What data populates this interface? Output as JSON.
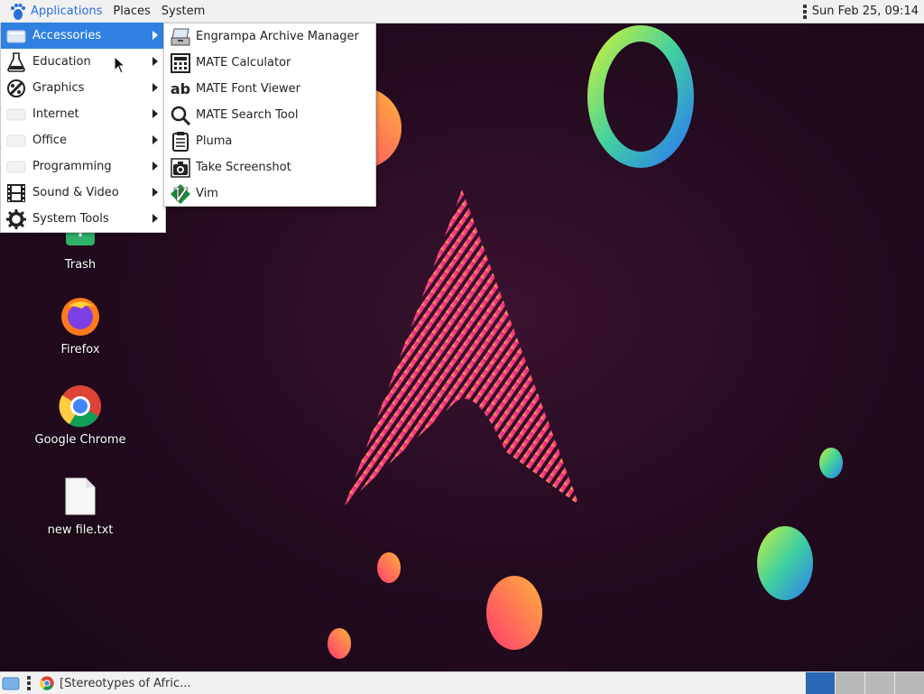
{
  "top_panel": {
    "menus": [
      {
        "label": "Applications",
        "icon": "mate-foot-icon"
      },
      {
        "label": "Places"
      },
      {
        "label": "System"
      }
    ],
    "clock": "Sun Feb 25, 09:14"
  },
  "apps_menu": {
    "items": [
      {
        "label": "Accessories",
        "icon": "accessories-icon",
        "selected": true
      },
      {
        "label": "Education",
        "icon": "flask-icon"
      },
      {
        "label": "Graphics",
        "icon": "graphics-icon"
      },
      {
        "label": "Internet",
        "icon": "internet-icon"
      },
      {
        "label": "Office",
        "icon": "office-icon"
      },
      {
        "label": "Programming",
        "icon": "programming-icon"
      },
      {
        "label": "Sound & Video",
        "icon": "film-icon"
      },
      {
        "label": "System Tools",
        "icon": "gear-icon"
      }
    ]
  },
  "submenu": {
    "items": [
      {
        "label": "Engrampa Archive Manager",
        "icon": "archive-icon"
      },
      {
        "label": "MATE Calculator",
        "icon": "calculator-icon"
      },
      {
        "label": "MATE Font Viewer",
        "icon": "font-icon"
      },
      {
        "label": "MATE Search Tool",
        "icon": "magnifier-icon"
      },
      {
        "label": "Pluma",
        "icon": "text-editor-icon"
      },
      {
        "label": "Take Screenshot",
        "icon": "camera-icon"
      },
      {
        "label": "Vim",
        "icon": "vim-icon"
      }
    ],
    "font_icon_text": "ab"
  },
  "desktop": {
    "icons": [
      {
        "label": "Trash",
        "icon": "trash-icon"
      },
      {
        "label": "Firefox",
        "icon": "firefox-icon"
      },
      {
        "label": "Google Chrome",
        "icon": "chrome-icon"
      },
      {
        "label": "new file.txt",
        "icon": "text-file-icon"
      }
    ]
  },
  "bottom_panel": {
    "task_label": "[Stereotypes of Afric...",
    "workspaces": 4,
    "active_workspace": 1
  },
  "colors": {
    "selection": "#2f80e0",
    "active_menu_text": "#2a6fd6",
    "panel_bg": "#f1f1f1"
  }
}
